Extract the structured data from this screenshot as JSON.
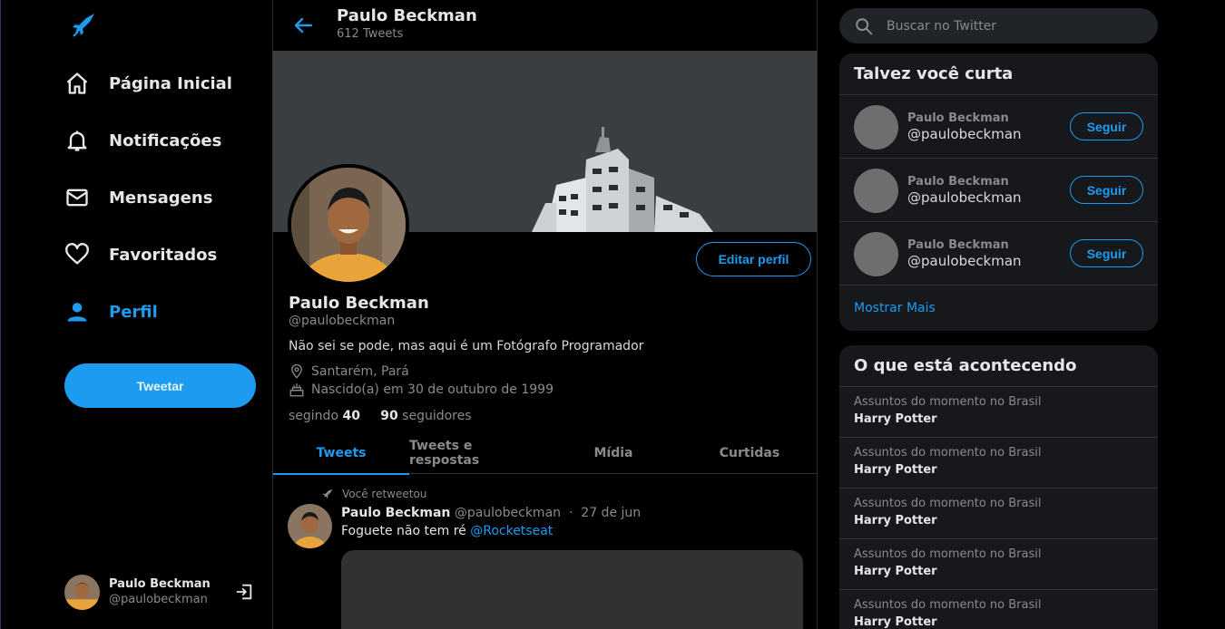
{
  "nav": {
    "items": [
      {
        "label": "Página Inicial",
        "icon": "home-icon"
      },
      {
        "label": "Notificações",
        "icon": "bell-icon"
      },
      {
        "label": "Mensagens",
        "icon": "mail-icon"
      },
      {
        "label": "Favoritados",
        "icon": "heart-icon"
      },
      {
        "label": "Perfil",
        "icon": "person-icon",
        "active": true
      }
    ],
    "tweet_button": "Tweetar",
    "user": {
      "name": "Paulo Beckman",
      "handle": "@paulobeckman"
    }
  },
  "header": {
    "title": "Paulo Beckman",
    "subtitle": "612 Tweets"
  },
  "profile": {
    "edit_button": "Editar perfil",
    "name": "Paulo Beckman",
    "handle": "@paulobeckman",
    "bio": "Não sei se pode, mas aqui é um Fotógrafo Programador",
    "location": "Santarém, Pará",
    "birth": "Nascido(a) em 30 de outubro de 1999",
    "following_count": "40",
    "following_label": "segindo",
    "followers_count": "90",
    "followers_label": "seguidores"
  },
  "tabs": [
    {
      "label": "Tweets",
      "active": true
    },
    {
      "label": "Tweets e respostas"
    },
    {
      "label": "Mídia"
    },
    {
      "label": "Curtidas"
    }
  ],
  "tweet": {
    "retweet_label": "Você retweetou",
    "name": "Paulo Beckman",
    "handle": "@paulobeckman",
    "separator": "·",
    "date": "27 de jun",
    "text": "Foguete não tem ré",
    "mention": "@Rocketseat"
  },
  "sidebar": {
    "search_placeholder": "Buscar no Twitter",
    "who_title": "Talvez você curta",
    "who": [
      {
        "name": "Paulo Beckman",
        "handle": "@paulobeckman",
        "button": "Seguir"
      },
      {
        "name": "Paulo Beckman",
        "handle": "@paulobeckman",
        "button": "Seguir"
      },
      {
        "name": "Paulo Beckman",
        "handle": "@paulobeckman",
        "button": "Seguir"
      }
    ],
    "show_more": "Mostrar Mais",
    "trends_title": "O que está acontecendo",
    "trends": [
      {
        "context": "Assuntos do momento no Brasil",
        "topic": "Harry Potter"
      },
      {
        "context": "Assuntos do momento no Brasil",
        "topic": "Harry Potter"
      },
      {
        "context": "Assuntos do momento no Brasil",
        "topic": "Harry Potter"
      },
      {
        "context": "Assuntos do momento no Brasil",
        "topic": "Harry Potter"
      },
      {
        "context": "Assuntos do momento no Brasil",
        "topic": "Harry Potter"
      }
    ]
  },
  "colors": {
    "accent": "#1d9bf0",
    "background": "#000000",
    "card": "#16181c"
  }
}
